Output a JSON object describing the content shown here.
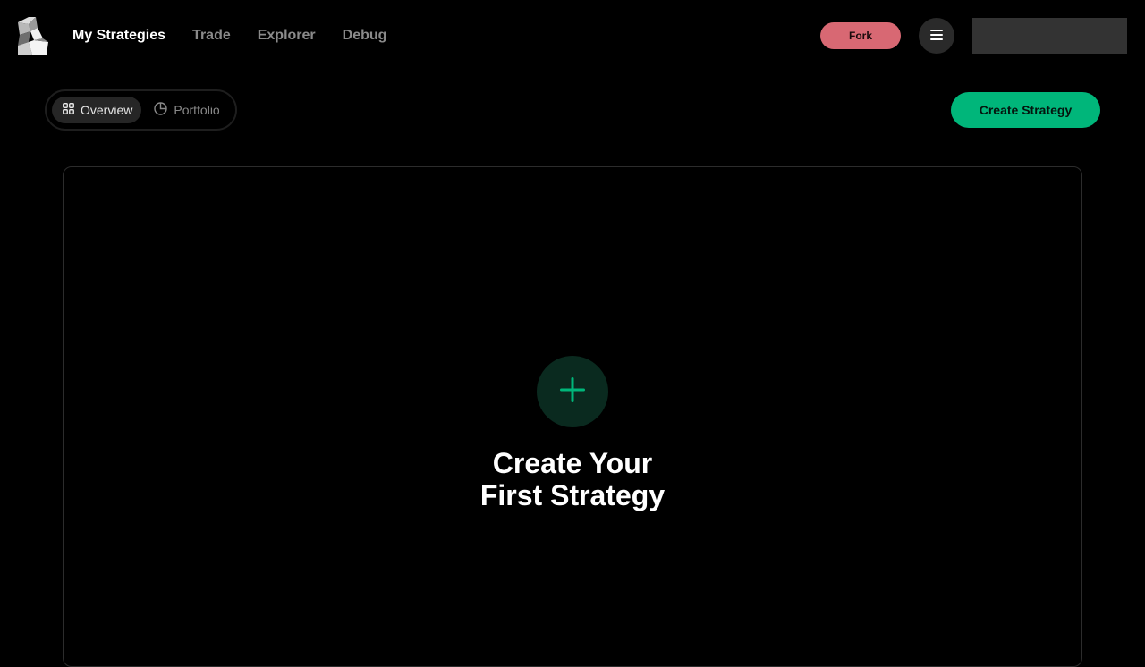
{
  "header": {
    "nav": [
      {
        "label": "My Strategies",
        "active": true
      },
      {
        "label": "Trade",
        "active": false
      },
      {
        "label": "Explorer",
        "active": false
      },
      {
        "label": "Debug",
        "active": false
      }
    ],
    "fork_label": "Fork",
    "menu_icon": "hamburger-menu-icon"
  },
  "tabs": [
    {
      "label": "Overview",
      "icon": "grid-icon",
      "active": true
    },
    {
      "label": "Portfolio",
      "icon": "pie-chart-icon",
      "active": false
    }
  ],
  "actions": {
    "create_strategy_label": "Create Strategy"
  },
  "empty_state": {
    "title_line1": "Create Your",
    "title_line2": "First Strategy",
    "icon": "plus-icon"
  },
  "colors": {
    "background": "#000000",
    "accent_green": "#00b67a",
    "fork_pink": "#d86873"
  }
}
